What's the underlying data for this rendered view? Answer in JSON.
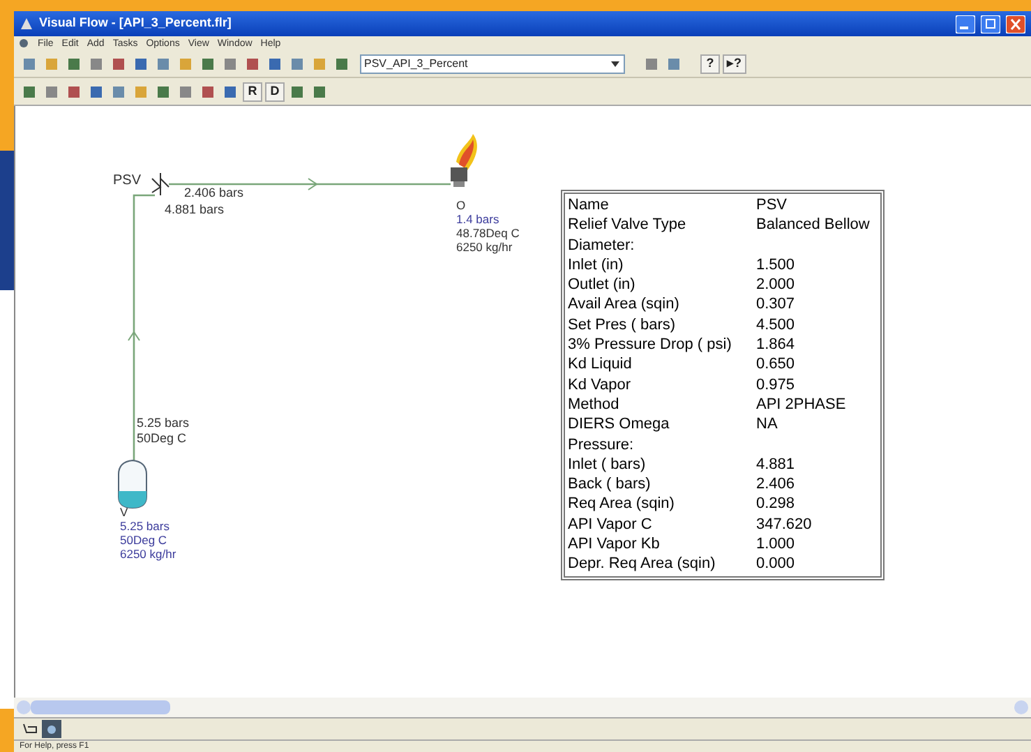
{
  "window": {
    "title": "Visual Flow - [API_3_Percent.flr]"
  },
  "menu": [
    "File",
    "Edit",
    "Add",
    "Tasks",
    "Options",
    "View",
    "Window",
    "Help"
  ],
  "toolbar": {
    "combo_value": "PSV_API_3_Percent",
    "help_buttons": [
      "?",
      "▸?"
    ],
    "letter_buttons": [
      "R",
      "D"
    ]
  },
  "diagram": {
    "labels": [
      {
        "kind": "tag",
        "lines": [
          {
            "text": "PSV",
            "color": "#333333"
          }
        ]
      },
      {
        "kind": "stream",
        "lines": [
          {
            "text": "2.406 bars",
            "color": "#333333"
          }
        ]
      },
      {
        "kind": "stream",
        "lines": [
          {
            "text": "4.881 bars",
            "color": "#333333"
          }
        ]
      },
      {
        "kind": "node",
        "lines": [
          {
            "text": "O",
            "color": "#333333"
          },
          {
            "text": "1.4 bars",
            "color": "#3c3c9c"
          },
          {
            "text": "48.78Deq C",
            "color": "#333333"
          },
          {
            "text": "6250 kg/hr",
            "color": "#333333"
          }
        ]
      },
      {
        "kind": "stream",
        "lines": [
          {
            "text": "5.25 bars",
            "color": "#333333"
          },
          {
            "text": "50Deg C",
            "color": "#333333"
          }
        ]
      },
      {
        "kind": "node",
        "lines": [
          {
            "text": "V",
            "color": "#333333"
          },
          {
            "text": "5.25 bars",
            "color": "#3c3c9c"
          },
          {
            "text": "50Deg C",
            "color": "#3c3c9c"
          },
          {
            "text": "6250 kg/hr",
            "color": "#3c3c9c"
          }
        ]
      }
    ]
  },
  "properties": [
    {
      "label": "Name",
      "value": "PSV"
    },
    {
      "label": "Relief Valve Type",
      "value": "Balanced Bellow"
    },
    {
      "label": "Diameter:"
    },
    {
      "label": "Inlet (in)",
      "value": "1.500"
    },
    {
      "label": "Outlet (in)",
      "value": "2.000"
    },
    {
      "label": "Avail Area (sqin)",
      "value": "0.307"
    },
    {
      "label": "Set Pres ( bars)",
      "value": "4.500"
    },
    {
      "label": "3% Pressure Drop ( psi)",
      "value": "1.864"
    },
    {
      "label": "Kd Liquid",
      "value": "0.650"
    },
    {
      "label": "Kd Vapor",
      "value": "0.975"
    },
    {
      "label": "Method",
      "value": "API 2PHASE"
    },
    {
      "label": "DIERS Omega",
      "value": "NA"
    },
    {
      "label": "Pressure:"
    },
    {
      "label": "Inlet ( bars)",
      "value": "4.881"
    },
    {
      "label": "Back ( bars)",
      "value": "2.406"
    },
    {
      "label": "Req Area (sqin)",
      "value": "0.298"
    },
    {
      "label": "API Vapor C",
      "value": "347.620"
    },
    {
      "label": "API Vapor Kb",
      "value": "1.000"
    },
    {
      "label": "Depr. Req Area (sqin)",
      "value": "0.000"
    }
  ],
  "status_bar": {
    "text": "For Help, press F1"
  }
}
